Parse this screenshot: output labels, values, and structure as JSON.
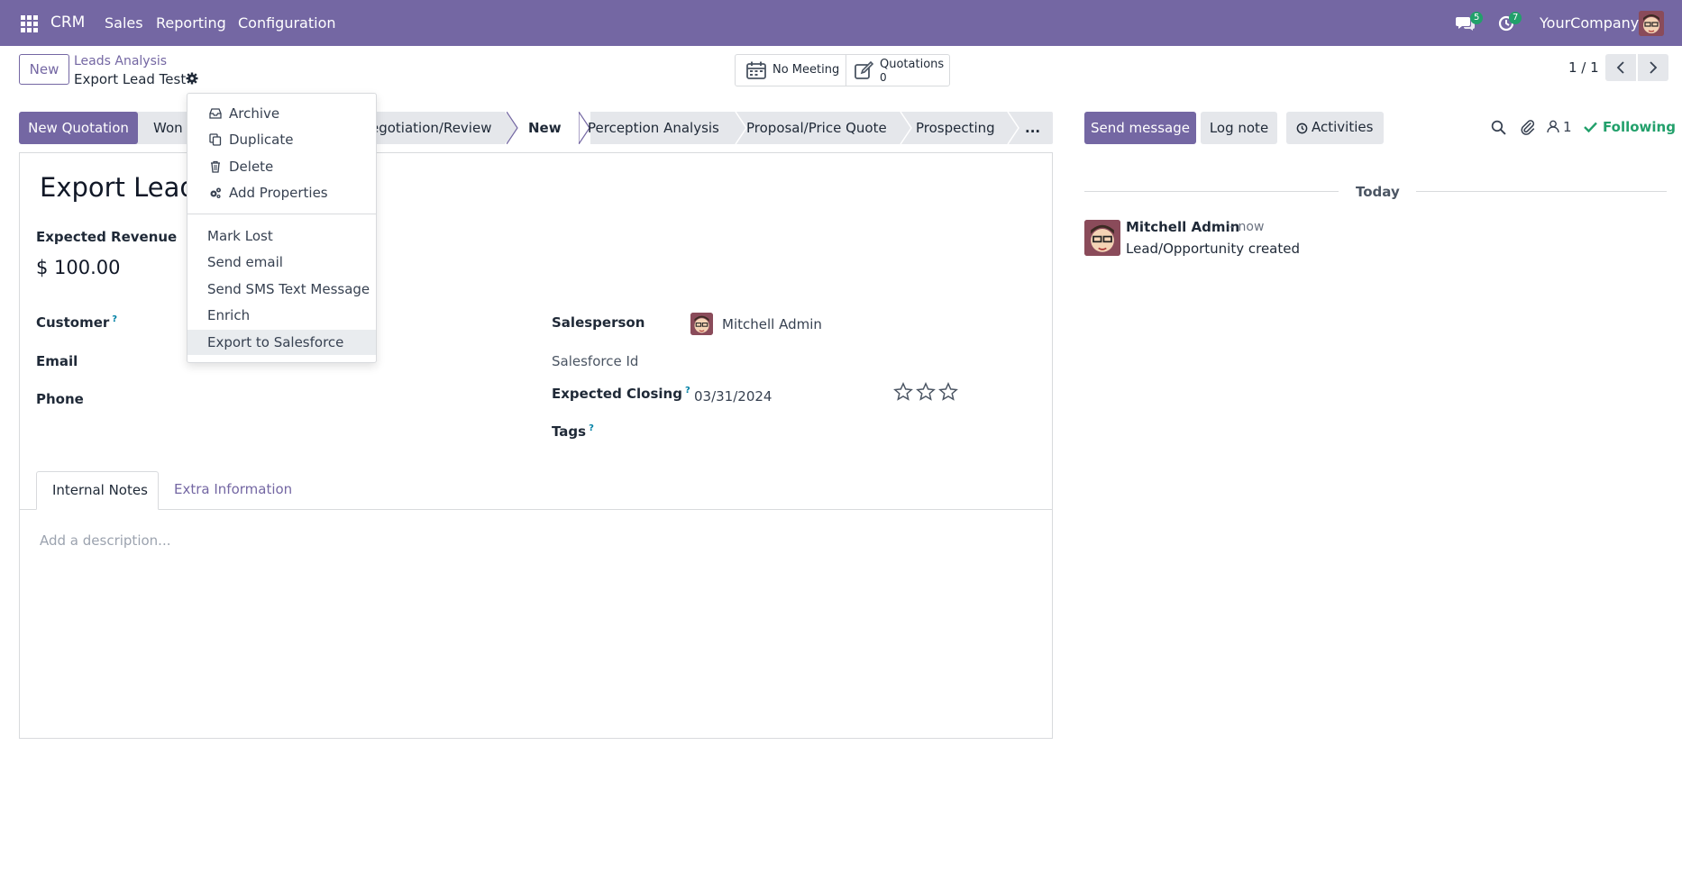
{
  "topbar": {
    "app_name": "CRM",
    "menu": [
      "Sales",
      "Reporting",
      "Configuration"
    ],
    "messages_count": "5",
    "activities_count": "7",
    "company": "YourCompany"
  },
  "control_panel": {
    "new_label": "New",
    "breadcrumb_parent": "Leads Analysis",
    "record_name": "Export Lead Test",
    "smart_buttons": {
      "meeting_label": "No Meeting",
      "quotations_label": "Quotations",
      "quotations_count": "0"
    },
    "pager": "1 / 1"
  },
  "actions": {
    "new_quotation": "New Quotation",
    "won": "Won"
  },
  "stages": [
    "egotiation/Review",
    "New",
    "Perception Analysis",
    "Proposal/Price Quote",
    "Prospecting",
    "..."
  ],
  "dropdown": {
    "items": [
      {
        "label": "Archive",
        "icon": "archive-icon"
      },
      {
        "label": "Duplicate",
        "icon": "copy-icon"
      },
      {
        "label": "Delete",
        "icon": "trash-icon"
      },
      {
        "label": "Add Properties",
        "icon": "cogs-icon"
      }
    ],
    "actions": [
      "Mark Lost",
      "Send email",
      "Send SMS Text Message",
      "Enrich",
      "Export to Salesforce"
    ]
  },
  "form": {
    "title": "Export Lead",
    "expected_revenue_label": "Expected Revenue",
    "expected_revenue": "$ 100.00",
    "customer_label": "Customer",
    "email_label": "Email",
    "phone_label": "Phone",
    "salesperson_label": "Salesperson",
    "salesperson": "Mitchell Admin",
    "salesforce_id_label": "Salesforce Id",
    "expected_closing_label": "Expected Closing",
    "expected_closing": "03/31/2024",
    "tags_label": "Tags",
    "help_mark": "?",
    "tabs": [
      "Internal Notes",
      "Extra Information"
    ],
    "description_placeholder": "Add a description..."
  },
  "chatter": {
    "send_message": "Send message",
    "log_note": "Log note",
    "activities": "Activities",
    "followers_count": "1",
    "following": "Following",
    "date_separator": "Today",
    "message": {
      "author": "Mitchell Admin",
      "time": "- now",
      "body": "Lead/Opportunity created"
    }
  },
  "colors": {
    "brand": "#7467a3",
    "accent": "#0180a5",
    "success": "#22a06b"
  }
}
